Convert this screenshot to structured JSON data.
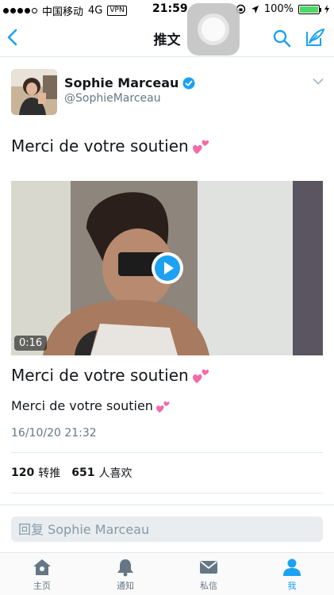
{
  "status_bar": {
    "carrier": "中国移动",
    "network": "4G",
    "vpn": "VPN",
    "time": "21:59",
    "battery": "100%",
    "battery_level": 1.0
  },
  "nav": {
    "title": "推文"
  },
  "tweet": {
    "author_name": "Sophie Marceau",
    "author_handle": "@SophieMarceau",
    "text": "Merci de votre soutien",
    "video_duration": "0:16",
    "card_title": "Merci de votre soutien",
    "card_subtitle": "Merci de votre soutien",
    "timestamp": "16/10/20 21:32",
    "retweets": "120",
    "retweets_label": "转推",
    "likes": "651",
    "likes_label": "人喜欢"
  },
  "reply": {
    "placeholder": "回复 Sophie Marceau"
  },
  "tabbar": {
    "items": [
      {
        "label": "主页",
        "icon": "home-icon"
      },
      {
        "label": "通知",
        "icon": "bell-icon"
      },
      {
        "label": "私信",
        "icon": "envelope-icon"
      },
      {
        "label": "我",
        "icon": "person-icon"
      }
    ],
    "active_index": 3
  },
  "colors": {
    "accent": "#1da1f2",
    "heart": "#e0245e",
    "secondary_text": "#657786"
  }
}
